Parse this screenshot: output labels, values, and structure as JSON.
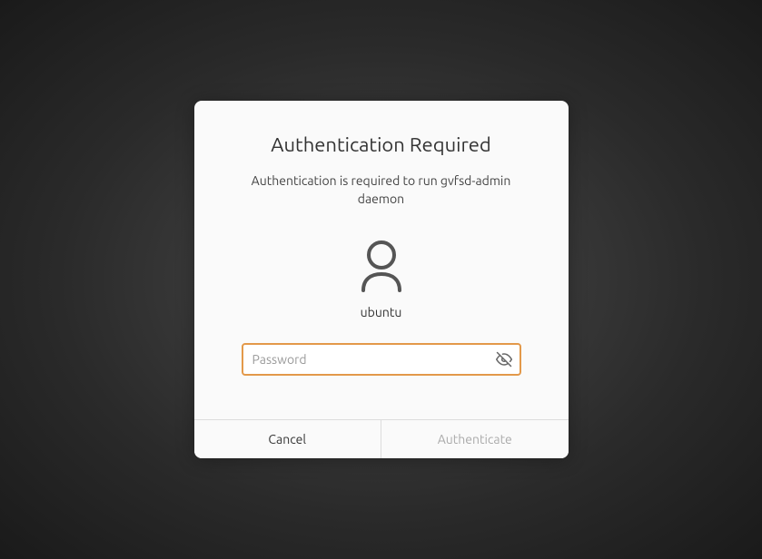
{
  "dialog": {
    "title": "Authentication Required",
    "message": "Authentication is required to run gvfsd-admin daemon",
    "username": "ubuntu",
    "password_placeholder": "Password",
    "password_value": "",
    "buttons": {
      "cancel": "Cancel",
      "authenticate": "Authenticate"
    }
  }
}
